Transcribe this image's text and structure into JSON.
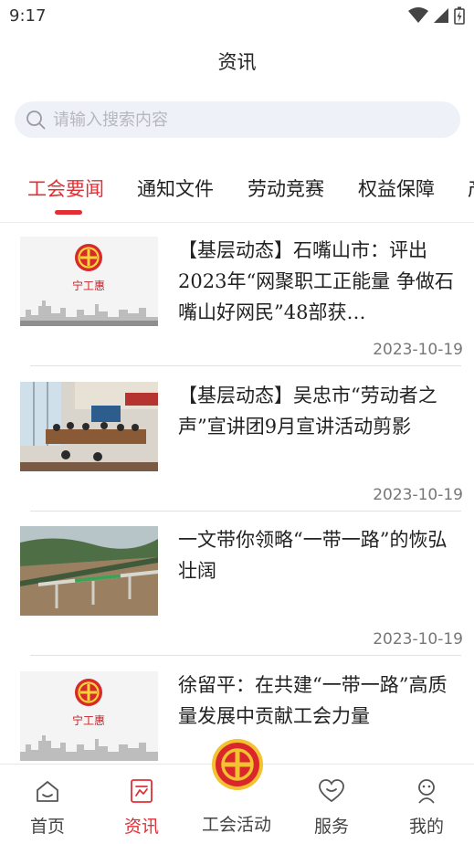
{
  "status_bar": {
    "time": "9:17"
  },
  "header": {
    "title": "资讯"
  },
  "search": {
    "placeholder": "请输入搜索内容"
  },
  "tabs": [
    {
      "label": "工会要闻",
      "active": true
    },
    {
      "label": "通知文件",
      "active": false
    },
    {
      "label": "劳动竞赛",
      "active": false
    },
    {
      "label": "权益保障",
      "active": false
    },
    {
      "label": "产",
      "active": false
    }
  ],
  "articles": [
    {
      "title": "【基层动态】石嘴山市：评出2023年“网聚职工正能量 争做石嘴山好网民”48部获…",
      "date": "2023-10-19",
      "thumb_caption": "宁工惠"
    },
    {
      "title": "【基层动态】吴忠市“劳动者之声”宣讲团9月宣讲活动剪影",
      "date": "2023-10-19"
    },
    {
      "title": "一文带你领略“一带一路”的恢弘壮阔",
      "date": "2023-10-19"
    },
    {
      "title": "徐留平：在共建“一带一路”高质量发展中贡献工会力量",
      "date": "",
      "thumb_caption": "宁工惠"
    }
  ],
  "bottom_nav": [
    {
      "label": "首页",
      "icon": "home-icon"
    },
    {
      "label": "资讯",
      "icon": "news-icon",
      "active": true
    },
    {
      "label": "工会活动",
      "icon": "union-emblem-icon"
    },
    {
      "label": "服务",
      "icon": "heart-service-icon"
    },
    {
      "label": "我的",
      "icon": "profile-icon"
    }
  ],
  "colors": {
    "accent": "#e03035",
    "search_bg": "#eef1f8"
  }
}
